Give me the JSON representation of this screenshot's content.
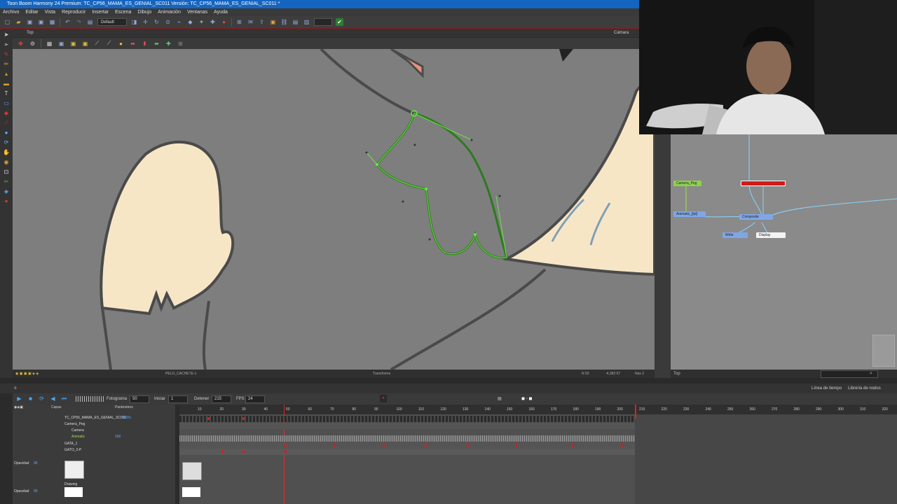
{
  "window": {
    "title": "Toon Boom Harmony 24 Premium: TC_CP56_MAMA_ES_GENIAL_SC011 Versión: TC_CP56_MAMA_ES_GENIAL_SC011 *"
  },
  "menu": [
    "Archivo",
    "Editar",
    "Vista",
    "Reproducir",
    "Insertar",
    "Escena",
    "Dibujo",
    "Animación",
    "Ventanas",
    "Ayuda"
  ],
  "toolbar": {
    "workspace": "Default"
  },
  "view": {
    "tab": "Top",
    "camera_label": "Cámara"
  },
  "canvas_status": {
    "layer": "PELO_CACHETE-1",
    "tool": "Transforme",
    "zoom": "N 93",
    "coords": "-4,383 67",
    "frame": "Nav 2"
  },
  "node_view": {
    "nodes": [
      {
        "label": "Camera_Peg",
        "color": "#8cd24a"
      },
      {
        "label": "",
        "color": "#d11a1a"
      },
      {
        "label": "Animatic_[tpl]",
        "color": "#7fa6e6"
      },
      {
        "label": "Composite",
        "color": "#7fa6e6"
      },
      {
        "label": "Write",
        "color": "#7fa6e6"
      },
      {
        "label": "Display",
        "color": "#f3f3f3"
      }
    ],
    "status": "Top"
  },
  "timeline": {
    "tabs": [
      "Línea de tiempo",
      "Librería de nodos"
    ],
    "fotograma_label": "Fotograma",
    "fotograma": "50",
    "iniciar_label": "Iniciar",
    "iniciar": "1",
    "detener_label": "Detener",
    "detener": "215",
    "fps_label": "FPS",
    "fps": "24",
    "columns": {
      "capas": "Capas",
      "parametros": "Parámetros"
    },
    "layers": [
      {
        "name": "TC_CP56_MAMA_ES_GENIAL_SC011",
        "param": "100%"
      },
      {
        "name": "Camera_Peg",
        "param": ""
      },
      {
        "name": "Camera",
        "param": ""
      },
      {
        "name": "Animatic",
        "param": "100"
      },
      {
        "name": "GATA_1",
        "param": ""
      },
      {
        "name": "GATO_2-P",
        "param": ""
      },
      {
        "name": "Opacidad",
        "param": "99"
      },
      {
        "name": "Drawing",
        "param": ""
      },
      {
        "name": "Opacidad",
        "param": "99"
      }
    ],
    "ruler": [
      "10",
      "20",
      "30",
      "40",
      "50",
      "60",
      "70",
      "80",
      "90",
      "100",
      "110",
      "120",
      "130",
      "140",
      "150",
      "160",
      "170",
      "180",
      "190",
      "200",
      "210",
      "220",
      "230",
      "240",
      "250",
      "260",
      "270",
      "280",
      "290",
      "300",
      "310",
      "320"
    ]
  }
}
